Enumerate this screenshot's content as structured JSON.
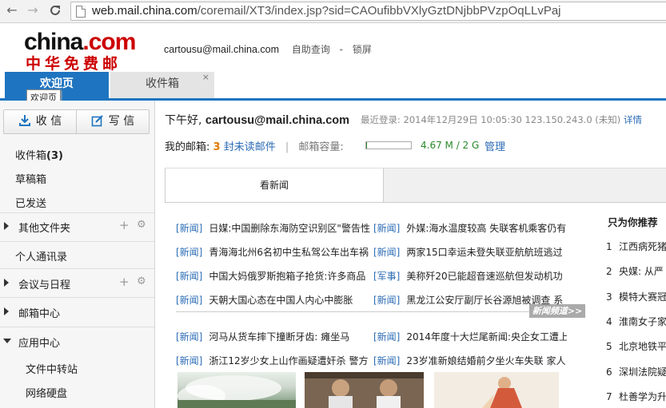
{
  "browser": {
    "url_host": "web.mail.china.com",
    "url_rest": "/coremail/XT3/index.jsp?sid=CAOufibbVXlyGztDNjbbPVzpOqLLvPaj"
  },
  "header": {
    "logo_en_prefix": "china",
    "logo_en_dot": ".",
    "logo_en_suffix": "com",
    "logo_cn": "中华免费邮",
    "email": "cartousu@mail.china.com",
    "self_query": "自助查询",
    "dash": "-",
    "lock_screen": "锁屏"
  },
  "tabs": {
    "home": "欢迎页",
    "inbox": "收件箱",
    "close": "×",
    "tooltip": "欢迎页"
  },
  "sidebar": {
    "receive": "收 信",
    "compose": "写 信",
    "inbox_label": "收件箱",
    "inbox_count": "(3)",
    "drafts": "草稿箱",
    "sent": "已发送",
    "other_folders": "其他文件夹",
    "contacts": "个人通讯录",
    "calendar": "会议与日程",
    "mail_center": "邮箱中心",
    "app_center": "应用中心",
    "file_transfer": "文件中转站",
    "net_disk": "网络硬盘",
    "plus": "+",
    "gear": "⚙"
  },
  "main": {
    "greeting_prefix": "下午好,",
    "greeting_email": "cartousu@mail.china.com",
    "last_login": "最近登录: 2014年12月29日 10:05:30 123.150.243.0 (未知)",
    "details": "详情",
    "my_mailbox": "我的邮箱:",
    "unread_count": "3",
    "unread_label": "封未读邮件",
    "sep": "|",
    "capacity_label": "邮箱容量:",
    "capacity_fraction": 0.0023,
    "capacity_text": "4.67 M / 2 G",
    "manage": "管理"
  },
  "news": {
    "tab": "看新闻",
    "tag_news": "[新闻]",
    "tag_military": "[军事]",
    "rows": [
      {
        "left_tag": "[新闻]",
        "left": "日媒:中国删除东海防空识别区\"警告性",
        "right_tag": "[新闻]",
        "right": "外媒:海水温度较高 失联客机乘客仍有"
      },
      {
        "left_tag": "[新闻]",
        "left": "青海海北州6名初中生私驾公车出车祸",
        "right_tag": "[新闻]",
        "right": "两家15口幸运未登失联亚航航班逃过"
      },
      {
        "left_tag": "[新闻]",
        "left": "中国大妈俄罗斯抱箱子抢货:许多商品",
        "right_tag": "[军事]",
        "right": "美称歼20已能超音速巡航但发动机功"
      },
      {
        "left_tag": "[新闻]",
        "left": "天朝大国心态在中国人内心中膨胀",
        "right_tag": "[新闻]",
        "right": "黑龙江公安厅副厅长谷源旭被调查 系"
      },
      {
        "left_tag": "[新闻]",
        "left": "河马从货车摔下撞断牙齿: 瘫坐马",
        "right_tag": "[新闻]",
        "right": "2014年度十大烂尾新闻:央企女工遭上"
      },
      {
        "left_tag": "[新闻]",
        "left": "浙江12岁少女上山作画疑遭奸杀 警方",
        "right_tag": "[新闻]",
        "right": "23岁准新娘结婚前夕坐火车失联 家人"
      }
    ],
    "more": "新闻频道>>",
    "rec_title": "只为你推荐",
    "rec": [
      {
        "n": "1",
        "t": "江西病死猪"
      },
      {
        "n": "2",
        "t": "央媒: 从严"
      },
      {
        "n": "3",
        "t": "模特大赛冠"
      },
      {
        "n": "4",
        "t": "淮南女子家"
      },
      {
        "n": "5",
        "t": "北京地铁平"
      },
      {
        "n": "6",
        "t": "深圳法院疑"
      },
      {
        "n": "7",
        "t": "杜善学为升"
      }
    ]
  },
  "colors": {
    "accent_blue": "#1e74c0",
    "link_blue": "#2b6bb5",
    "brand_red": "#cc0000",
    "unread_orange": "#e07b00",
    "quota_green": "#2a8a2a"
  }
}
